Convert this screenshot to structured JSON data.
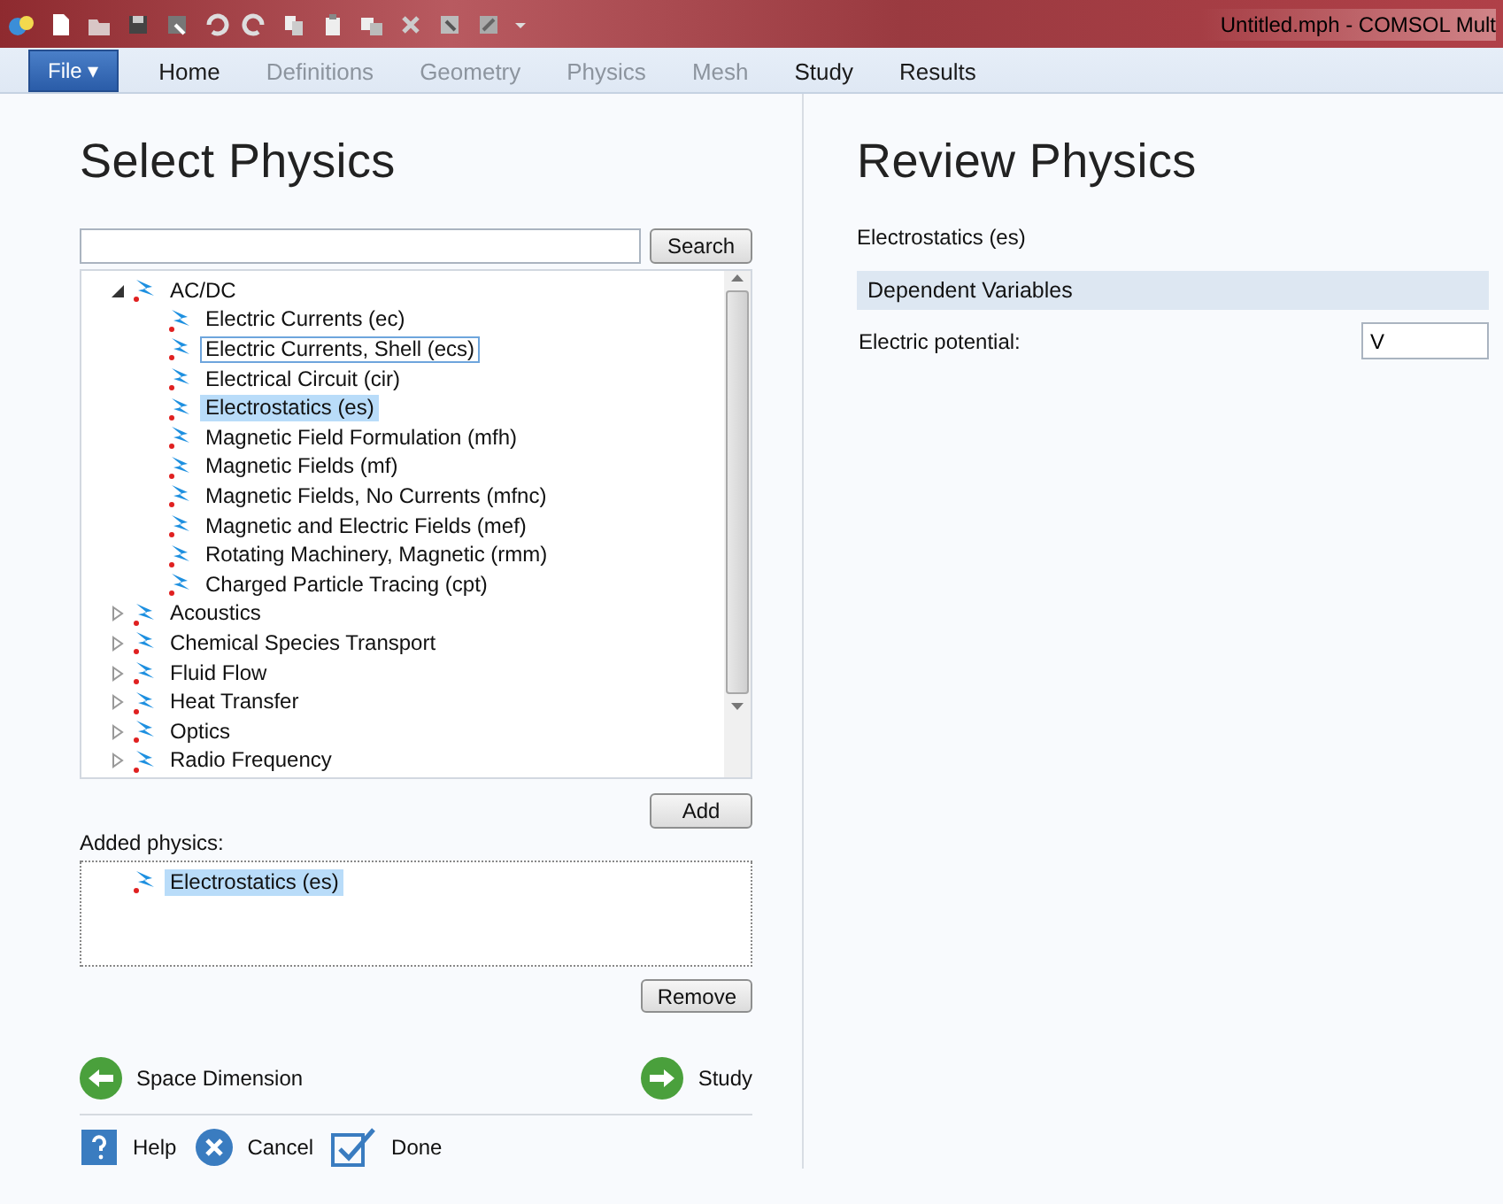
{
  "window": {
    "title": "Untitled.mph - COMSOL Mult"
  },
  "ribbon_tabs": [
    {
      "label": "File ▾",
      "kind": "file"
    },
    {
      "label": "Home",
      "kind": "tab",
      "disabled": false
    },
    {
      "label": "Definitions",
      "kind": "tab",
      "disabled": true
    },
    {
      "label": "Geometry",
      "kind": "tab",
      "disabled": true
    },
    {
      "label": "Physics",
      "kind": "tab",
      "disabled": true
    },
    {
      "label": "Mesh",
      "kind": "tab",
      "disabled": true
    },
    {
      "label": "Study",
      "kind": "tab",
      "disabled": false
    },
    {
      "label": "Results",
      "kind": "tab",
      "disabled": false
    }
  ],
  "select_physics": {
    "title": "Select Physics",
    "search_button": "Search",
    "tree": [
      {
        "label": "AC/DC",
        "expanded": true,
        "children": [
          {
            "label": "Electric Currents (ec)",
            "selected": false,
            "focused": false
          },
          {
            "label": "Electric Currents, Shell (ecs)",
            "selected": false,
            "focused": true
          },
          {
            "label": "Electrical Circuit (cir)",
            "selected": false,
            "focused": false
          },
          {
            "label": "Electrostatics (es)",
            "selected": true,
            "focused": false
          },
          {
            "label": "Magnetic Field Formulation (mfh)",
            "selected": false,
            "focused": false
          },
          {
            "label": "Magnetic Fields (mf)",
            "selected": false,
            "focused": false
          },
          {
            "label": "Magnetic Fields, No Currents (mfnc)",
            "selected": false,
            "focused": false
          },
          {
            "label": "Magnetic and Electric Fields (mef)",
            "selected": false,
            "focused": false
          },
          {
            "label": "Rotating Machinery, Magnetic (rmm)",
            "selected": false,
            "focused": false
          },
          {
            "label": "Charged Particle Tracing (cpt)",
            "selected": false,
            "focused": false
          }
        ]
      },
      {
        "label": "Acoustics",
        "expanded": false
      },
      {
        "label": "Chemical Species Transport",
        "expanded": false
      },
      {
        "label": "Fluid Flow",
        "expanded": false
      },
      {
        "label": "Heat Transfer",
        "expanded": false
      },
      {
        "label": "Optics",
        "expanded": false
      },
      {
        "label": "Radio Frequency",
        "expanded": false
      }
    ],
    "add_button": "Add",
    "added_label": "Added physics:",
    "added": [
      {
        "label": "Electrostatics (es)",
        "selected": true
      }
    ],
    "remove_button": "Remove",
    "back": "Space Dimension",
    "next": "Study",
    "footer": [
      {
        "label": "Help",
        "kind": "help"
      },
      {
        "label": "Cancel",
        "kind": "cancel"
      },
      {
        "label": "Done",
        "kind": "done"
      }
    ]
  },
  "review_physics": {
    "title": "Review Physics",
    "interface": "Electrostatics (es)",
    "section": "Dependent Variables",
    "fields": [
      {
        "label": "Electric potential:",
        "value": "V"
      }
    ]
  }
}
